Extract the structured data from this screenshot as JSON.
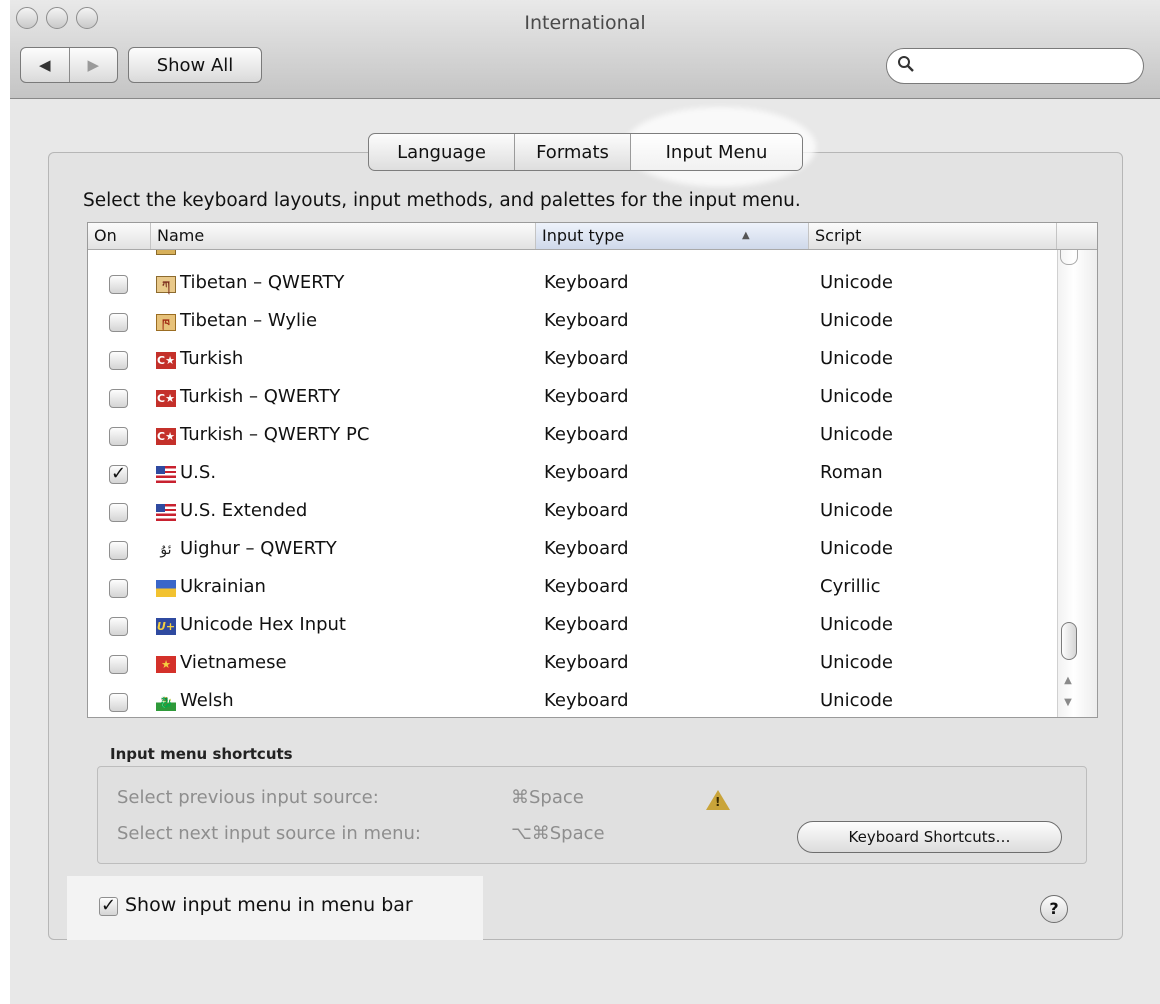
{
  "window": {
    "title": "International"
  },
  "toolbar": {
    "back_icon": "◀",
    "forward_icon": "▶",
    "show_all_label": "Show All",
    "search_icon": "⚲",
    "search_placeholder": ""
  },
  "tabs": [
    {
      "label": "Language",
      "selected": false
    },
    {
      "label": "Formats",
      "selected": false
    },
    {
      "label": "Input Menu",
      "selected": true
    }
  ],
  "instructions": "Select the keyboard layouts, input methods, and palettes for the input menu.",
  "table": {
    "columns": {
      "on": "On",
      "name": "Name",
      "input_type": "Input type",
      "script": "Script"
    },
    "sort_indicator": "▲",
    "rows": [
      {
        "on": false,
        "name": "Tibetan – QWERTY",
        "type": "Keyboard",
        "script": "Unicode",
        "icon": "tibetan-flag-icon"
      },
      {
        "on": false,
        "name": "Tibetan – Wylie",
        "type": "Keyboard",
        "script": "Unicode",
        "icon": "tibetan-wylie-icon"
      },
      {
        "on": false,
        "name": "Turkish",
        "type": "Keyboard",
        "script": "Unicode",
        "icon": "turkish-flag-icon"
      },
      {
        "on": false,
        "name": "Turkish – QWERTY",
        "type": "Keyboard",
        "script": "Unicode",
        "icon": "turkish-flag-icon"
      },
      {
        "on": false,
        "name": "Turkish – QWERTY PC",
        "type": "Keyboard",
        "script": "Unicode",
        "icon": "turkish-pc-flag-icon"
      },
      {
        "on": true,
        "name": "U.S.",
        "type": "Keyboard",
        "script": "Roman",
        "icon": "us-flag-icon"
      },
      {
        "on": false,
        "name": "U.S. Extended",
        "type": "Keyboard",
        "script": "Unicode",
        "icon": "us-extended-flag-icon"
      },
      {
        "on": false,
        "name": "Uighur – QWERTY",
        "type": "Keyboard",
        "script": "Unicode",
        "icon": "uighur-glyph-icon"
      },
      {
        "on": false,
        "name": "Ukrainian",
        "type": "Keyboard",
        "script": "Cyrillic",
        "icon": "ukrainian-flag-icon"
      },
      {
        "on": false,
        "name": "Unicode Hex Input",
        "type": "Keyboard",
        "script": "Unicode",
        "icon": "unicode-hex-icon"
      },
      {
        "on": false,
        "name": "Vietnamese",
        "type": "Keyboard",
        "script": "Unicode",
        "icon": "vietnamese-flag-icon"
      },
      {
        "on": false,
        "name": "Welsh",
        "type": "Keyboard",
        "script": "Unicode",
        "icon": "welsh-flag-icon"
      }
    ]
  },
  "shortcuts": {
    "heading": "Input menu shortcuts",
    "previous_label": "Select previous input source:",
    "previous_keys": "⌘Space",
    "next_label": "Select next input source in menu:",
    "next_keys": "⌥⌘Space",
    "warning_icon": "!",
    "keyboard_shortcuts_button": "Keyboard Shortcuts…"
  },
  "show_input_menu": {
    "checked": true,
    "label": "Show input menu in menu bar"
  },
  "help_label": "?",
  "colors": {
    "accent_blue": "#2f5fb3",
    "selection_highlight": "#ffffff",
    "warning": "#c9a43a"
  }
}
